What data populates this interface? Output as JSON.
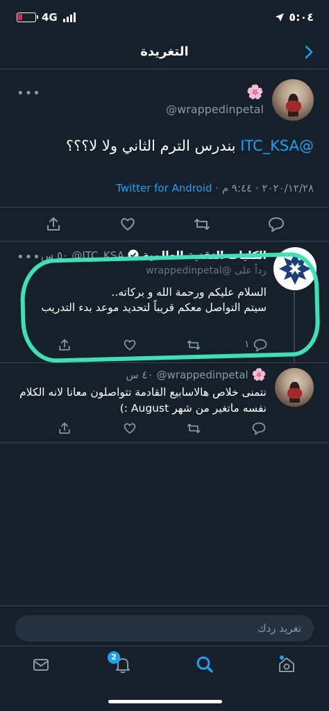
{
  "status_bar": {
    "network": "4G",
    "time": "٥:٠٤"
  },
  "header": {
    "title": "التغريدة"
  },
  "tweet": {
    "emoji": "🌸",
    "handle": "@wrappedinpetal",
    "mention": "@ITC_KSA",
    "body": " بندرس الترم الثاني ولا لا؟؟؟",
    "date": "٢٠٢٠/١٢/٢٨ · ٩:٤٤ م · ",
    "client": "Twitter for Android"
  },
  "reply1": {
    "name": "الكليات التقنية العالمية",
    "handle": "@ITC_KSA",
    "time": "٥٠ س",
    "replying_to": "رداً على @wrappedinpetal",
    "line1": "السلام عليكم ورحمة الله و بركاته..",
    "line2": "سيتم التواصل معكم قريباً لتحديد موعد بدء التدريب",
    "reply_count": "١"
  },
  "reply2": {
    "emoji": "🌸",
    "handle": "@wrappedinpetal",
    "time": "٤٠ س",
    "text": "نتمنى خلاص هالاسابيع القادمة تتواصلون معانا لانه الكلام نفسه ماتغير من شهر August :)"
  },
  "compose": {
    "placeholder": "تغريد ردك"
  },
  "tabs": {
    "notifications_badge": "2"
  },
  "colors": {
    "background": "#15202b",
    "accent": "#1da1f2",
    "highlight": "#3ee0b6"
  },
  "icons": [
    "battery-icon",
    "signal-icon",
    "location-arrow-icon",
    "back-chevron-icon",
    "more-icon",
    "share-icon",
    "like-icon",
    "retweet-icon",
    "reply-icon",
    "verified-icon",
    "mail-icon",
    "bell-icon",
    "search-icon",
    "home-icon"
  ]
}
